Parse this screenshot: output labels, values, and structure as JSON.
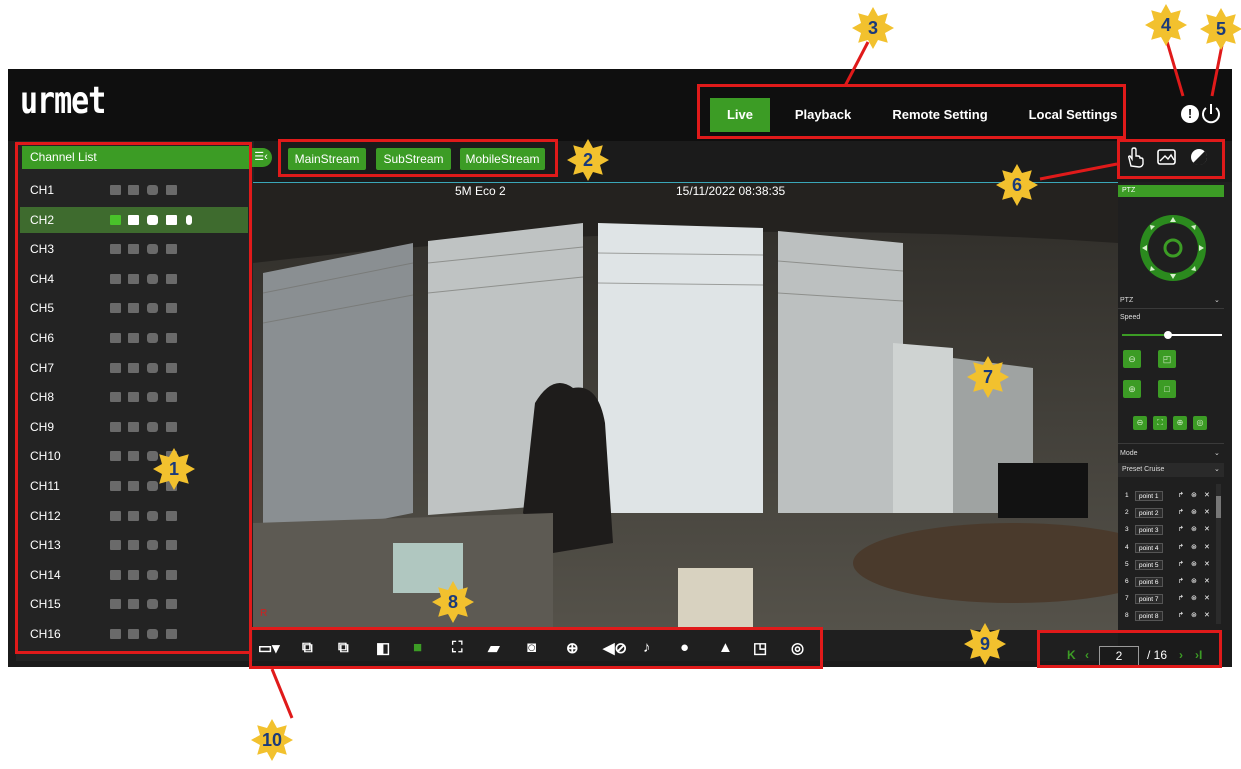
{
  "app": {
    "logo": "urmet"
  },
  "nav": {
    "items": [
      {
        "label": "Live",
        "active": true
      },
      {
        "label": "Playback",
        "active": false
      },
      {
        "label": "Remote Setting",
        "active": false
      },
      {
        "label": "Local Settings",
        "active": false
      }
    ],
    "info_icon": "info-icon",
    "power_icon": "power-icon"
  },
  "channel_list": {
    "title": "Channel List",
    "selected": "CH2",
    "channels": [
      "CH1",
      "CH2",
      "CH3",
      "CH4",
      "CH5",
      "CH6",
      "CH7",
      "CH8",
      "CH9",
      "CH10",
      "CH11",
      "CH12",
      "CH13",
      "CH14",
      "CH15",
      "CH16"
    ],
    "row_icons": [
      "play-icon",
      "record-icon",
      "snapshot-icon",
      "image-icon",
      "mic-icon"
    ]
  },
  "streams": {
    "main": "MainStream",
    "sub": "SubStream",
    "mobile": "MobileStream"
  },
  "tools": [
    "hand-icon",
    "image-adjust-icon",
    "contrast-icon"
  ],
  "video": {
    "quality": "5M Eco 2",
    "timestamp": "15/11/2022 08:38:35",
    "rec_flag": "R"
  },
  "ptz": {
    "title": "PTZ",
    "dropdown": "PTZ",
    "speed_label": "Speed",
    "speed_value": 0.5,
    "mode_label": "Mode",
    "cruise_mode": "Preset Cruise",
    "points": [
      {
        "n": "1",
        "name": "point 1"
      },
      {
        "n": "2",
        "name": "point 2"
      },
      {
        "n": "3",
        "name": "point 3"
      },
      {
        "n": "4",
        "name": "point 4"
      },
      {
        "n": "5",
        "name": "point 5"
      },
      {
        "n": "6",
        "name": "point 6"
      },
      {
        "n": "7",
        "name": "point 7"
      },
      {
        "n": "8",
        "name": "point 8"
      }
    ]
  },
  "toolbar_icons": [
    "layout-icon",
    "previous-group-icon",
    "next-group-icon",
    "fullscreen-icon",
    "sequence-icon",
    "aspect-icon",
    "record-all-icon",
    "snapshot-icon",
    "zoom-icon",
    "mute-icon",
    "talk-icon",
    "light-icon",
    "alarm-icon",
    "pip-icon",
    "fisheye-icon"
  ],
  "pager": {
    "current": "2",
    "total": "/ 16"
  },
  "callouts": [
    "1",
    "2",
    "3",
    "4",
    "5",
    "6",
    "7",
    "8",
    "9",
    "10"
  ],
  "colors": {
    "accent": "#3c9c25",
    "annotation": "#e01a1a",
    "callout": "#f2c12e"
  }
}
